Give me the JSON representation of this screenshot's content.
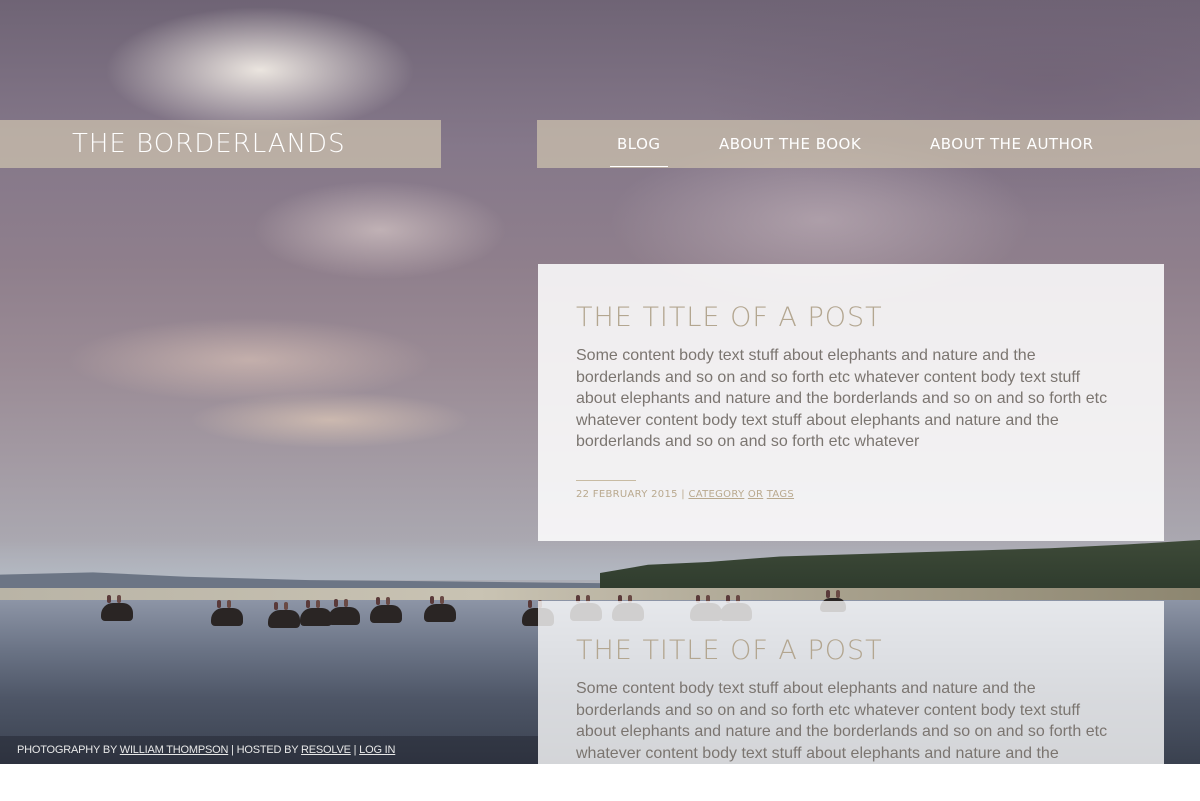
{
  "header": {
    "site_title": "THE BORDERLANDS",
    "nav": [
      {
        "label": "BLOG",
        "active": true
      },
      {
        "label": "ABOUT THE BOOK",
        "active": false
      },
      {
        "label": "ABOUT THE AUTHOR",
        "active": false
      }
    ]
  },
  "posts": [
    {
      "title": "THE TITLE OF A POST",
      "body": "Some content body text stuff about elephants and nature and the borderlands and so on and so forth etc whatever content body text stuff about elephants and nature and the borderlands and so on and so forth etc whatever content body text stuff about elephants and nature and the borderlands and so on and so forth etc whatever",
      "date": "22 FEBRUARY 2015",
      "separator": "|",
      "category_label": "CATEGORY",
      "or_label": "OR",
      "tags_label": "TAGS"
    },
    {
      "title": "THE TITLE OF A POST",
      "body": "Some content body text stuff about elephants and nature and the borderlands and so on and so forth etc whatever content body text stuff about elephants and nature and the borderlands and so on and so forth etc whatever content body text stuff about elephants and nature and the"
    }
  ],
  "footer": {
    "photo_prefix": "PHOTOGRAPHY BY",
    "photographer": "WILLIAM THOMPSON",
    "hosted_prefix": "| HOSTED BY",
    "host": "RESOLVE",
    "separator": "|",
    "login": "LOG IN"
  },
  "colors": {
    "bar_bg": "#cec3af",
    "title_accent": "#b3a690",
    "body_text": "#7b7570",
    "meta_text": "#b9a98e"
  }
}
